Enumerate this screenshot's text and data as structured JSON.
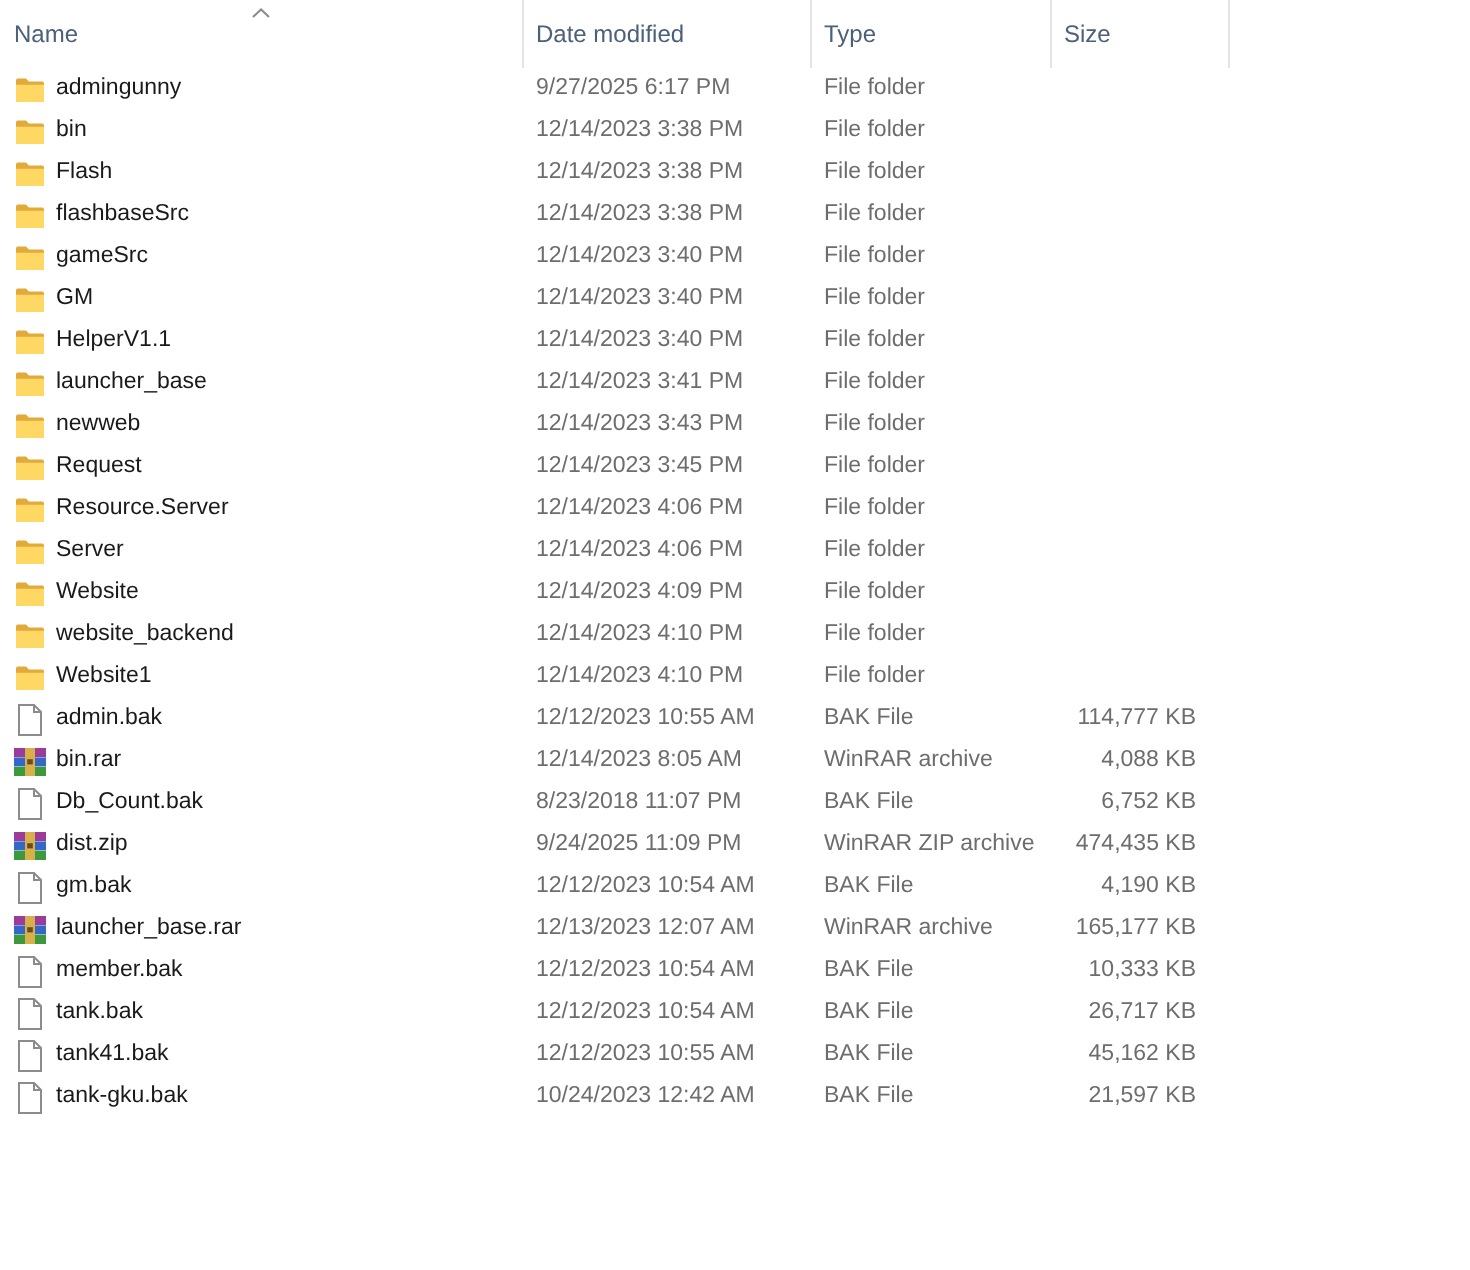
{
  "columns": [
    {
      "label": "Name",
      "sorted": true
    },
    {
      "label": "Date modified",
      "sorted": false
    },
    {
      "label": "Type",
      "sorted": false
    },
    {
      "label": "Size",
      "sorted": false
    }
  ],
  "files": [
    {
      "kind": "folder",
      "name": "admingunny",
      "date_modified": "9/27/2025 6:17 PM",
      "type": "File folder"
    },
    {
      "kind": "folder",
      "name": "bin",
      "date_modified": "12/14/2023 3:38 PM",
      "type": "File folder"
    },
    {
      "kind": "folder",
      "name": "Flash",
      "date_modified": "12/14/2023 3:38 PM",
      "type": "File folder"
    },
    {
      "kind": "folder",
      "name": "flashbaseSrc",
      "date_modified": "12/14/2023 3:38 PM",
      "type": "File folder"
    },
    {
      "kind": "folder",
      "name": "gameSrc",
      "date_modified": "12/14/2023 3:40 PM",
      "type": "File folder"
    },
    {
      "kind": "folder",
      "name": "GM",
      "date_modified": "12/14/2023 3:40 PM",
      "type": "File folder"
    },
    {
      "kind": "folder",
      "name": "HelperV1.1",
      "date_modified": "12/14/2023 3:40 PM",
      "type": "File folder"
    },
    {
      "kind": "folder",
      "name": "launcher_base",
      "date_modified": "12/14/2023 3:41 PM",
      "type": "File folder"
    },
    {
      "kind": "folder",
      "name": "newweb",
      "date_modified": "12/14/2023 3:43 PM",
      "type": "File folder"
    },
    {
      "kind": "folder",
      "name": "Request",
      "date_modified": "12/14/2023 3:45 PM",
      "type": "File folder"
    },
    {
      "kind": "folder",
      "name": "Resource.Server",
      "date_modified": "12/14/2023 4:06 PM",
      "type": "File folder"
    },
    {
      "kind": "folder",
      "name": "Server",
      "date_modified": "12/14/2023 4:06 PM",
      "type": "File folder"
    },
    {
      "kind": "folder",
      "name": "Website",
      "date_modified": "12/14/2023 4:09 PM",
      "type": "File folder"
    },
    {
      "kind": "folder",
      "name": "website_backend",
      "date_modified": "12/14/2023 4:10 PM",
      "type": "File folder"
    },
    {
      "kind": "folder",
      "name": "Website1",
      "date_modified": "12/14/2023 4:10 PM",
      "type": "File folder"
    },
    {
      "kind": "file",
      "name": "admin.bak",
      "date_modified": "12/12/2023 10:55 AM",
      "type": "BAK File",
      "size": "114,777 KB"
    },
    {
      "kind": "archive",
      "name": "bin.rar",
      "date_modified": "12/14/2023 8:05 AM",
      "type": "WinRAR archive",
      "size": "4,088 KB"
    },
    {
      "kind": "file",
      "name": "Db_Count.bak",
      "date_modified": "8/23/2018 11:07 PM",
      "type": "BAK File",
      "size": "6,752 KB"
    },
    {
      "kind": "archive",
      "name": "dist.zip",
      "date_modified": "9/24/2025 11:09 PM",
      "type": "WinRAR ZIP archive",
      "size": "474,435 KB"
    },
    {
      "kind": "file",
      "name": "gm.bak",
      "date_modified": "12/12/2023 10:54 AM",
      "type": "BAK File",
      "size": "4,190 KB"
    },
    {
      "kind": "archive",
      "name": "launcher_base.rar",
      "date_modified": "12/13/2023 12:07 AM",
      "type": "WinRAR archive",
      "size": "165,177 KB"
    },
    {
      "kind": "file",
      "name": "member.bak",
      "date_modified": "12/12/2023 10:54 AM",
      "type": "BAK File",
      "size": "10,333 KB"
    },
    {
      "kind": "file",
      "name": "tank.bak",
      "date_modified": "12/12/2023 10:54 AM",
      "type": "BAK File",
      "size": "26,717 KB"
    },
    {
      "kind": "file",
      "name": "tank41.bak",
      "date_modified": "12/12/2023 10:55 AM",
      "type": "BAK File",
      "size": "45,162 KB"
    },
    {
      "kind": "file",
      "name": "tank-gku.bak",
      "date_modified": "10/24/2023 12:42 AM",
      "type": "BAK File",
      "size": "21,597 KB"
    }
  ]
}
